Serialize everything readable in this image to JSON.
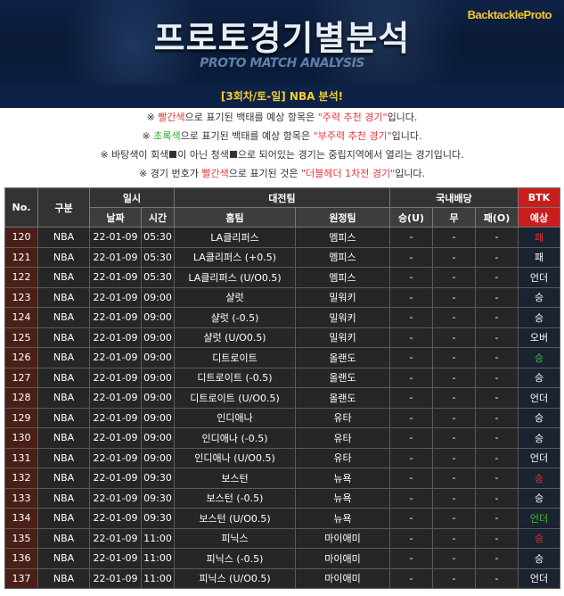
{
  "banner": {
    "title": "프로토경기별분석",
    "subtitle": "PROTO MATCH ANALYSIS",
    "brand": "BacktackleProto"
  },
  "round_label": "[3회차/토-일] NBA 분석!",
  "notes": [
    {
      "pre": "※ ",
      "highlight": "빨간색",
      "mid": "으로 표기된 백태를 예상 항목은 ",
      "quote": "\"주력 추천 경기\"",
      "post": "입니다.",
      "color": "red"
    },
    {
      "pre": "※ ",
      "highlight": "초록색",
      "mid": "으로 표기된 백태를 예상 항목은 ",
      "quote": "\"부주력 추천 경기\"",
      "post": "입니다.",
      "color": "green"
    },
    {
      "text1": "※ 바탕색이 회색",
      "text2": "이 아닌 청색",
      "text3": "으로 되어있는 경기는 중립지역에서 열리는 경기입니다."
    },
    {
      "pre": "※ 경기 번호가 ",
      "highlight": "빨간색",
      "mid": "으로 표기된 것은 ",
      "quote": "\"더블헤더 1차전 경기\"",
      "post": "입니다.",
      "color": "red"
    }
  ],
  "headers": {
    "no": "No.",
    "type": "구분",
    "datetime": "일시",
    "date": "날짜",
    "time": "시간",
    "matchup": "대전팀",
    "home": "홈팀",
    "away": "원정팀",
    "odds": "국내배당",
    "win": "승(U)",
    "draw": "무",
    "lose": "패(O)",
    "btk1": "BTK",
    "btk2": "예상"
  },
  "rows": [
    {
      "no": "120",
      "type": "NBA",
      "date": "22-01-09",
      "time": "05:30",
      "home": "LA클리퍼스",
      "away": "멤피스",
      "away_color": "white",
      "win": "-",
      "draw": "-",
      "lose": "-",
      "pred": "패",
      "pred_color": "red"
    },
    {
      "no": "121",
      "type": "NBA",
      "date": "22-01-09",
      "time": "05:30",
      "home": "LA클리퍼스 (+0.5)",
      "away": "멤피스",
      "away_color": "white",
      "win": "-",
      "draw": "-",
      "lose": "-",
      "pred": "패",
      "pred_color": "white"
    },
    {
      "no": "122",
      "type": "NBA",
      "date": "22-01-09",
      "time": "05:30",
      "home": "LA클리퍼스 (U/O0.5)",
      "away": "멤피스",
      "away_color": "white",
      "win": "-",
      "draw": "-",
      "lose": "-",
      "pred": "언더",
      "pred_color": "white"
    },
    {
      "no": "123",
      "type": "NBA",
      "date": "22-01-09",
      "time": "09:00",
      "home": "샬럿",
      "away": "밀워키",
      "away_color": "yellow",
      "win": "-",
      "draw": "-",
      "lose": "-",
      "pred": "승",
      "pred_color": "white"
    },
    {
      "no": "124",
      "type": "NBA",
      "date": "22-01-09",
      "time": "09:00",
      "home": "샬럿 (-0.5)",
      "away": "밀워키",
      "away_color": "yellow",
      "win": "-",
      "draw": "-",
      "lose": "-",
      "pred": "승",
      "pred_color": "white"
    },
    {
      "no": "125",
      "type": "NBA",
      "date": "22-01-09",
      "time": "09:00",
      "home": "샬럿 (U/O0.5)",
      "away": "밀워키",
      "away_color": "yellow",
      "win": "-",
      "draw": "-",
      "lose": "-",
      "pred": "오버",
      "pred_color": "white"
    },
    {
      "no": "126",
      "type": "NBA",
      "date": "22-01-09",
      "time": "09:00",
      "home": "디트로이트",
      "away": "올랜도",
      "away_color": "white",
      "win": "-",
      "draw": "-",
      "lose": "-",
      "pred": "승",
      "pred_color": "green"
    },
    {
      "no": "127",
      "type": "NBA",
      "date": "22-01-09",
      "time": "09:00",
      "home": "디트로이트 (-0.5)",
      "away": "올랜도",
      "away_color": "white",
      "win": "-",
      "draw": "-",
      "lose": "-",
      "pred": "승",
      "pred_color": "white"
    },
    {
      "no": "128",
      "type": "NBA",
      "date": "22-01-09",
      "time": "09:00",
      "home": "디트로이트 (U/O0.5)",
      "away": "올랜도",
      "away_color": "white",
      "win": "-",
      "draw": "-",
      "lose": "-",
      "pred": "언더",
      "pred_color": "white"
    },
    {
      "no": "129",
      "type": "NBA",
      "date": "22-01-09",
      "time": "09:00",
      "home": "인디애나",
      "away": "유타",
      "away_color": "yellow",
      "win": "-",
      "draw": "-",
      "lose": "-",
      "pred": "승",
      "pred_color": "white"
    },
    {
      "no": "130",
      "type": "NBA",
      "date": "22-01-09",
      "time": "09:00",
      "home": "인디애나 (-0.5)",
      "away": "유타",
      "away_color": "yellow",
      "win": "-",
      "draw": "-",
      "lose": "-",
      "pred": "승",
      "pred_color": "white"
    },
    {
      "no": "131",
      "type": "NBA",
      "date": "22-01-09",
      "time": "09:00",
      "home": "인디애나 (U/O0.5)",
      "away": "유타",
      "away_color": "yellow",
      "win": "-",
      "draw": "-",
      "lose": "-",
      "pred": "언더",
      "pred_color": "white"
    },
    {
      "no": "132",
      "type": "NBA",
      "date": "22-01-09",
      "time": "09:30",
      "home": "보스턴",
      "away": "뉴욕",
      "away_color": "white",
      "win": "-",
      "draw": "-",
      "lose": "-",
      "pred": "승",
      "pred_color": "red"
    },
    {
      "no": "133",
      "type": "NBA",
      "date": "22-01-09",
      "time": "09:30",
      "home": "보스턴 (-0.5)",
      "away": "뉴욕",
      "away_color": "white",
      "win": "-",
      "draw": "-",
      "lose": "-",
      "pred": "승",
      "pred_color": "white"
    },
    {
      "no": "134",
      "type": "NBA",
      "date": "22-01-09",
      "time": "09:30",
      "home": "보스턴 (U/O0.5)",
      "away": "뉴욕",
      "away_color": "white",
      "win": "-",
      "draw": "-",
      "lose": "-",
      "pred": "언더",
      "pred_color": "green"
    },
    {
      "no": "135",
      "type": "NBA",
      "date": "22-01-09",
      "time": "11:00",
      "home": "피닉스",
      "away": "마이애미",
      "away_color": "white",
      "win": "-",
      "draw": "-",
      "lose": "-",
      "pred": "승",
      "pred_color": "red"
    },
    {
      "no": "136",
      "type": "NBA",
      "date": "22-01-09",
      "time": "11:00",
      "home": "피닉스 (-0.5)",
      "away": "마이애미",
      "away_color": "white",
      "win": "-",
      "draw": "-",
      "lose": "-",
      "pred": "승",
      "pred_color": "white"
    },
    {
      "no": "137",
      "type": "NBA",
      "date": "22-01-09",
      "time": "11:00",
      "home": "피닉스 (U/O0.5)",
      "away": "마이애미",
      "away_color": "white",
      "win": "-",
      "draw": "-",
      "lose": "-",
      "pred": "언더",
      "pred_color": "white"
    }
  ]
}
